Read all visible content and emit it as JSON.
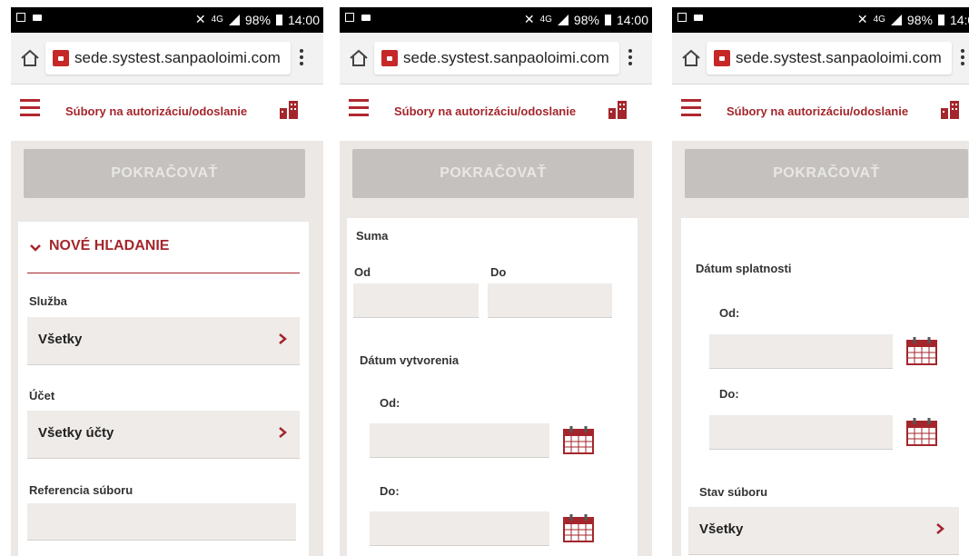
{
  "status_bar": {
    "network": "4G",
    "battery": "98%",
    "time": "14:00"
  },
  "browser": {
    "url": "sede.systest.sanpaoloimi.com"
  },
  "app_header": {
    "title": "Súbory na autorizáciu/odoslanie"
  },
  "continue_label": "POKRAČOVAŤ",
  "screen1": {
    "section_title": "NOVÉ HĽADANIE",
    "service_label": "Služba",
    "service_value": "Všetky",
    "account_label": "Účet",
    "account_value": "Všetky účty",
    "reference_label": "Referencia súboru"
  },
  "screen2": {
    "amount_label": "Suma",
    "from_label": "Od",
    "to_label": "Do",
    "created_label": "Dátum vytvorenia",
    "created_from": "Od:",
    "created_to": "Do:"
  },
  "screen3": {
    "due_label": "Dátum splatnosti",
    "due_from": "Od:",
    "due_to": "Do:",
    "status_label": "Stav súboru",
    "status_value": "Všetky"
  },
  "colors": {
    "brand": "#a4262c",
    "button_disabled": "#c4c1be",
    "background": "#ebe8e5"
  }
}
